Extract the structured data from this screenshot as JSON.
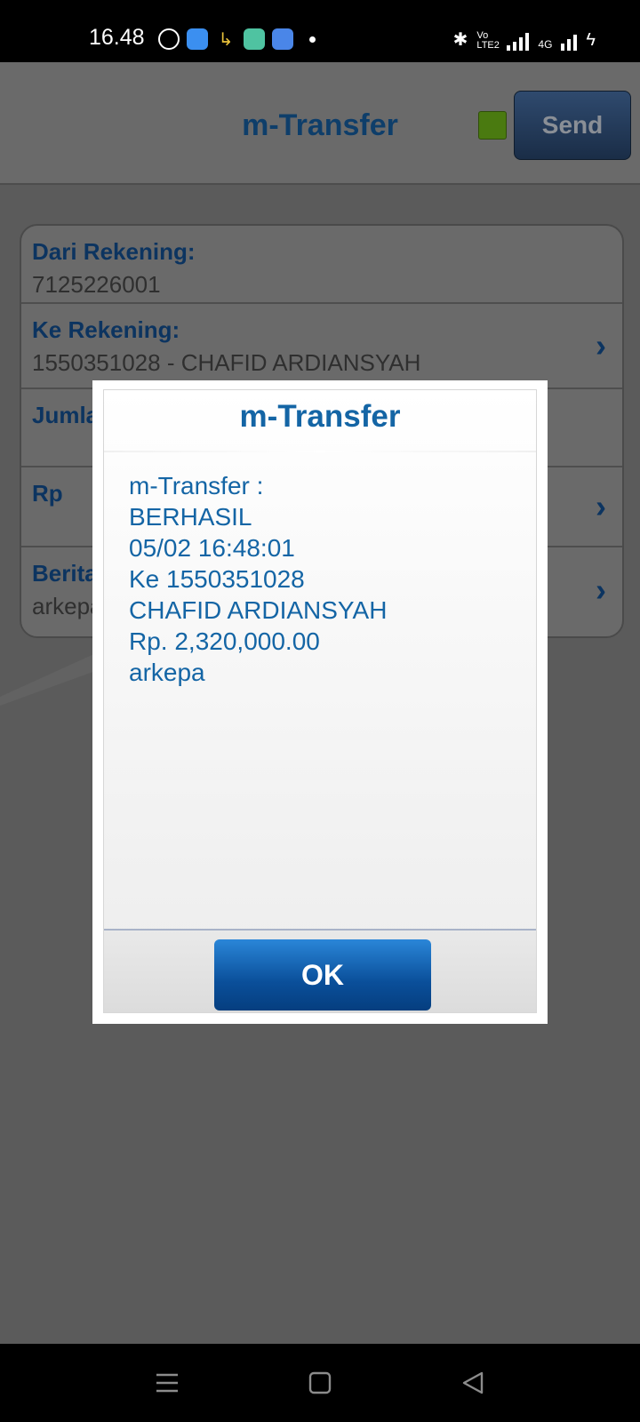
{
  "status_bar": {
    "time": "16.48",
    "icons": [
      "whatsapp-icon",
      "app-icon-blue",
      "missed-call-icon",
      "app-icon-teal",
      "app-icon-blue-2",
      "dot-indicator"
    ],
    "right_icons": [
      "bluetooth-icon",
      "volte-icon",
      "signal-icon",
      "4g-signal-icon",
      "charging-icon"
    ],
    "volte_text": "Vo LTE2",
    "network_text": "4G"
  },
  "header": {
    "title": "m-Transfer",
    "send_label": "Send",
    "status_color": "#4a7a10"
  },
  "form": {
    "rows": [
      {
        "label": "Dari Rekening:",
        "value": "7125226001"
      },
      {
        "label": "Ke Rekening:",
        "value": "1550351028 - CHAFID ARDIANSYAH"
      },
      {
        "label": "Jumla",
        "value": ""
      },
      {
        "label": "Rp",
        "value": ""
      },
      {
        "label": "Berita",
        "value": "arkepa"
      }
    ]
  },
  "dialog": {
    "title": "m-Transfer",
    "lines": [
      "m-Transfer :",
      "BERHASIL",
      "05/02 16:48:01",
      "Ke 1550351028",
      "CHAFID ARDIANSYAH",
      "Rp. 2,320,000.00",
      "arkepa"
    ],
    "ok_label": "OK",
    "accent_color": "#1465a5"
  },
  "nav": {
    "items": [
      "menu-icon",
      "home-icon",
      "back-icon"
    ]
  }
}
